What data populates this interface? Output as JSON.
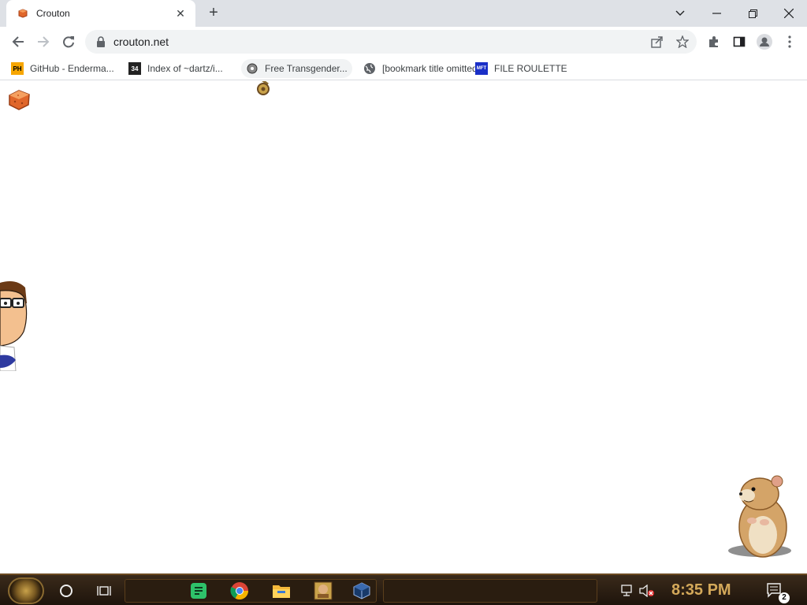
{
  "browser": {
    "tab": {
      "title": "Crouton"
    },
    "new_tab_icon": "plus-icon",
    "window_controls": [
      "tab-search-icon",
      "minimize-icon",
      "restore-icon",
      "close-icon"
    ]
  },
  "toolbar": {
    "url": "crouton.net",
    "icons": [
      "back-arrow-icon",
      "forward-arrow-icon",
      "reload-icon",
      "lock-icon",
      "share-icon",
      "star-icon",
      "puzzle-extensions-icon",
      "side-panel-icon",
      "profile-icon",
      "kebab-menu-icon"
    ]
  },
  "bookmarks": [
    {
      "label": "GitHub - Enderma...",
      "icon": "PH"
    },
    {
      "label": "Index of ~dartz/i...",
      "icon": "34"
    },
    {
      "label": "Free Transgender...",
      "icon": "gear"
    },
    {
      "label": "[bookmark title omitted]",
      "icon": "globe"
    },
    {
      "label": "FILE ROULETTE",
      "icon": "MFT"
    }
  ],
  "page": {
    "content": [
      "crouton-image",
      "cartoon-man-peeking",
      "hamster-animation",
      "cursor-ornament"
    ]
  },
  "taskbar": {
    "clock": "8:35 PM",
    "notification_count": "2",
    "apps": [
      "cortana-circle-icon",
      "task-view-icon",
      "notes-app-icon",
      "chrome-icon",
      "file-explorer-icon",
      "game-app-icon",
      "virtualbox-icon"
    ],
    "tray": [
      "network-icon",
      "volume-muted-icon",
      "notification-center-icon"
    ]
  },
  "colors": {
    "tabstrip": "#dee1e6",
    "omnibox": "#f1f3f4",
    "taskbar": "#2a1d10",
    "clock": "#d4a95a",
    "crouton": "#e0662a"
  }
}
